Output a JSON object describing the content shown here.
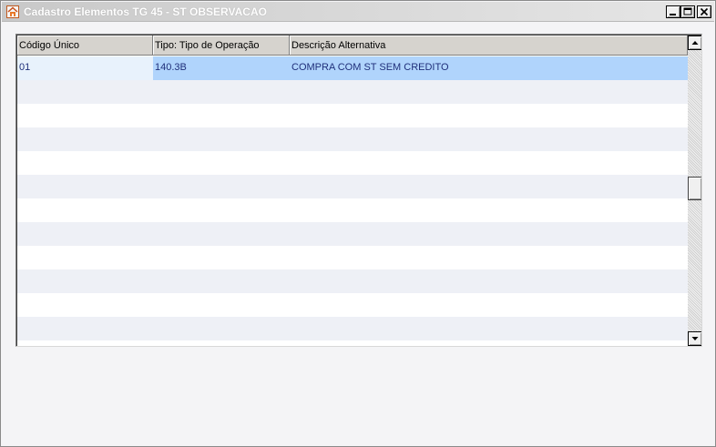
{
  "window": {
    "title": "Cadastro Elementos TG 45 - ST OBSERVACAO",
    "icon": "app-home-icon",
    "controls": [
      "minimize-icon",
      "maximize-icon",
      "close-icon"
    ]
  },
  "grid": {
    "columns": [
      "Código Único",
      "Tipo: Tipo de Operação",
      "Descrição Alternativa"
    ],
    "rows": [
      [
        "01",
        "140.3B",
        "COMPRA COM ST SEM CREDITO"
      ]
    ],
    "selected_row": 0
  },
  "colors": {
    "selection": "#b0d4fc",
    "alt_row": "#eef0f6",
    "cell_text": "#1f2f7a",
    "header_bg": "#d6d3ce"
  }
}
